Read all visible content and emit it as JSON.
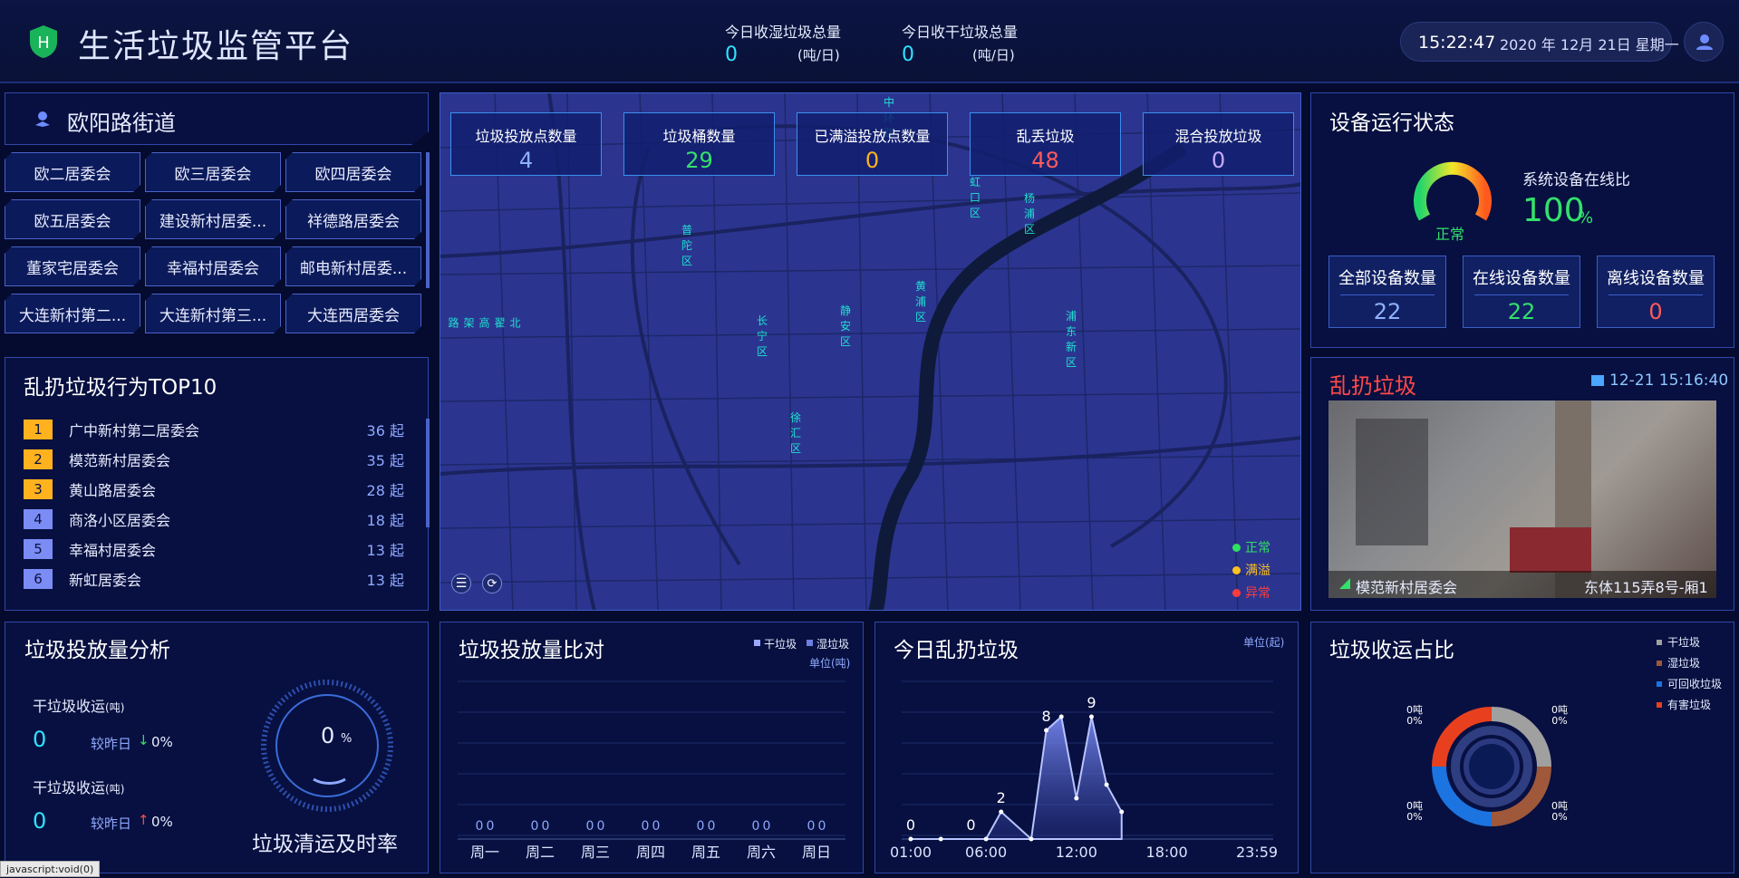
{
  "header": {
    "title": "生活垃圾监管平台",
    "wet_label": "今日收湿垃圾总量",
    "wet_value": "0",
    "wet_unit": "(吨/日)",
    "dry_label": "今日收干垃圾总量",
    "dry_value": "0",
    "dry_unit": "(吨/日)",
    "time": "15:22:47",
    "date": "2020 年 12月 21日 星期一"
  },
  "street": {
    "name": "欧阳路街道",
    "committees": [
      "欧二居委会",
      "欧三居委会",
      "欧四居委会",
      "欧五居委会",
      "建设新村居委...",
      "祥德路居委会",
      "董家宅居委会",
      "幸福村居委会",
      "邮电新村居委...",
      "大连新村第二...",
      "大连新村第三...",
      "大连西居委会"
    ]
  },
  "top10": {
    "title": "乱扔垃圾行为TOP10",
    "items": [
      {
        "rank": "1",
        "name": "广中新村第二居委会",
        "count": "36 起"
      },
      {
        "rank": "2",
        "name": "模范新村居委会",
        "count": "35 起"
      },
      {
        "rank": "3",
        "name": "黄山路居委会",
        "count": "28 起"
      },
      {
        "rank": "4",
        "name": "商洛小区居委会",
        "count": "18 起"
      },
      {
        "rank": "5",
        "name": "幸福村居委会",
        "count": "13 起"
      },
      {
        "rank": "6",
        "name": "新虹居委会",
        "count": "13 起"
      }
    ]
  },
  "map": {
    "stats": [
      {
        "label": "垃圾投放点数量",
        "value": "4",
        "color": "#8fb0ff"
      },
      {
        "label": "垃圾桶数量",
        "value": "29",
        "color": "#34e06b"
      },
      {
        "label": "已满溢投放点数量",
        "value": "0",
        "color": "#ffb21e"
      },
      {
        "label": "乱丢垃圾",
        "value": "48",
        "color": "#ff5a5a"
      },
      {
        "label": "混合投放垃圾",
        "value": "0",
        "color": "#c9a9ff"
      }
    ],
    "districts": [
      "中环路",
      "虹口区",
      "杨浦区",
      "普陀区",
      "黄浦区",
      "长宁区",
      "静安区",
      "浦东新区",
      "徐汇区",
      "北翟高架路",
      "延安高架路"
    ],
    "legend": [
      {
        "label": "正常",
        "color": "#30e060"
      },
      {
        "label": "满溢",
        "color": "#ffc21e"
      },
      {
        "label": "异常",
        "color": "#ff3b3b"
      }
    ]
  },
  "device": {
    "title": "设备运行状态",
    "gauge_label": "正常",
    "online_label": "系统设备在线比",
    "online_value": "100",
    "online_unit": "%",
    "boxes": [
      {
        "label": "全部设备数量",
        "value": "22",
        "color": "#8fb0ff"
      },
      {
        "label": "在线设备数量",
        "value": "22",
        "color": "#34e06b"
      },
      {
        "label": "离线设备数量",
        "value": "0",
        "color": "#ff5a5a"
      }
    ]
  },
  "camera": {
    "title": "乱扔垃圾",
    "timestamp": "12-21 15:16:40",
    "location": "模范新村居委会",
    "address": "东体115弄8号-厢1"
  },
  "volume": {
    "title": "垃圾投放量分析",
    "dry_label": "干垃圾收运",
    "unit": "(吨)",
    "dry_value": "0",
    "compare_label": "较昨日",
    "dry_change": "0%",
    "wet_label": "干垃圾收运",
    "wet_value": "0",
    "wet_change": "0%",
    "rate_value": "0",
    "rate_unit": "%",
    "rate_label": "垃圾清运及时率"
  },
  "compare": {
    "title": "垃圾投放量比对",
    "legend_dry": "干垃圾",
    "legend_wet": "湿垃圾",
    "unit": "单位(吨)",
    "days": [
      "周一",
      "周二",
      "周三",
      "周四",
      "周五",
      "周六",
      "周日"
    ]
  },
  "today": {
    "title": "今日乱扔垃圾",
    "unit": "单位(起)"
  },
  "ratio": {
    "title": "垃圾收运占比",
    "legend": [
      {
        "label": "干垃圾",
        "color": "#a0a0a0"
      },
      {
        "label": "湿垃圾",
        "color": "#a0583a"
      },
      {
        "label": "可回收垃圾",
        "color": "#1c74e0"
      },
      {
        "label": "有害垃圾",
        "color": "#e8401e"
      }
    ],
    "labels_top": "0吨",
    "labels_bottom": "0%"
  },
  "status_bar": "javascript:void(0)",
  "chart_data": [
    {
      "type": "bar",
      "title": "垃圾投放量比对",
      "categories": [
        "周一",
        "周二",
        "周三",
        "周四",
        "周五",
        "周六",
        "周日"
      ],
      "series": [
        {
          "name": "干垃圾",
          "values": [
            0,
            0,
            0,
            0,
            0,
            0,
            0
          ]
        },
        {
          "name": "湿垃圾",
          "values": [
            0,
            0,
            0,
            0,
            0,
            0,
            0
          ]
        }
      ]
    },
    {
      "type": "area",
      "title": "今日乱扔垃圾",
      "x": [
        "01:00",
        "06:00",
        "12:00",
        "18:00",
        "23:59"
      ],
      "points": [
        {
          "x": "01:00",
          "y": 0
        },
        {
          "x": "03:00",
          "y": 0
        },
        {
          "x": "06:00",
          "y": 0
        },
        {
          "x": "07:00",
          "y": 2
        },
        {
          "x": "09:00",
          "y": 0
        },
        {
          "x": "10:00",
          "y": 8
        },
        {
          "x": "11:00",
          "y": 9
        },
        {
          "x": "12:00",
          "y": 3
        },
        {
          "x": "13:00",
          "y": 9
        },
        {
          "x": "14:00",
          "y": 4
        },
        {
          "x": "15:00",
          "y": 2
        }
      ],
      "labels": [
        {
          "x": "01:00",
          "y": 0
        },
        {
          "x": "05:00",
          "y": 0
        },
        {
          "x": "07:00",
          "y": 2
        },
        {
          "x": "10:00",
          "y": 8
        },
        {
          "x": "13:00",
          "y": 9
        }
      ]
    },
    {
      "type": "pie",
      "title": "垃圾收运占比",
      "slices": [
        {
          "name": "干垃圾",
          "value": 0
        },
        {
          "name": "湿垃圾",
          "value": 0
        },
        {
          "name": "可回收垃圾",
          "value": 0
        },
        {
          "name": "有害垃圾",
          "value": 0
        }
      ]
    }
  ]
}
